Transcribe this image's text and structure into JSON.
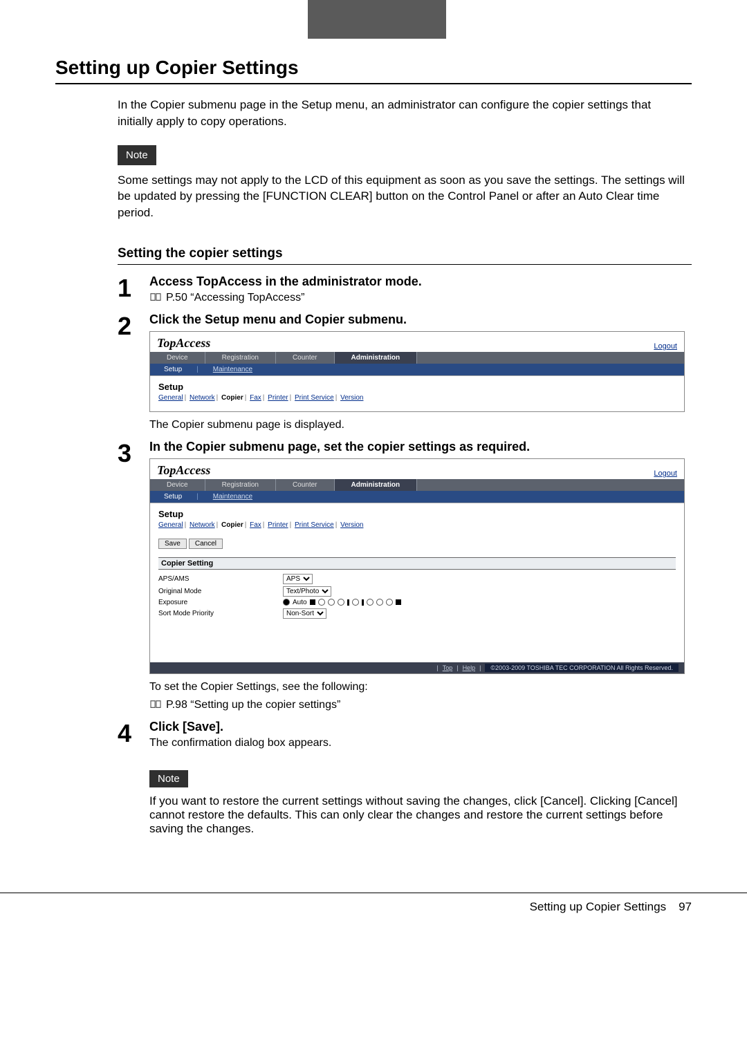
{
  "header": {
    "ribbon_color": "#5a5a5a"
  },
  "title": "Setting up Copier Settings",
  "intro": "In the Copier submenu page in the Setup menu, an administrator can configure the copier settings that initially apply to copy operations.",
  "note_label": "Note",
  "note_text": "Some settings may not apply to the LCD of this equipment as soon as you save the settings. The settings will be updated by pressing the [FUNCTION CLEAR] button on the Control Panel or after an Auto Clear time period.",
  "subsection": "Setting the copier settings",
  "steps": [
    {
      "num": "1",
      "title": "Access TopAccess in the administrator mode.",
      "ref": "P.50 “Accessing TopAccess”"
    },
    {
      "num": "2",
      "title": "Click the Setup menu and Copier submenu.",
      "after": "The Copier submenu page is displayed."
    },
    {
      "num": "3",
      "title": "In the Copier submenu page, set the copier settings as required.",
      "after1": "To set the Copier Settings, see the following:",
      "ref": "P.98 “Setting up the copier settings”"
    },
    {
      "num": "4",
      "title": "Click [Save].",
      "after": "The confirmation dialog box appears."
    }
  ],
  "note2_text": "If you want to restore the current settings without saving the changes, click [Cancel]. Clicking [Cancel] cannot restore the defaults.  This can only clear the changes and restore the current settings before saving the changes.",
  "footer": {
    "title": "Setting up Copier Settings",
    "page": "97"
  },
  "topaccess": {
    "logo": "TopAccess",
    "logout": "Logout",
    "main_tabs": [
      "Device",
      "Registration",
      "Counter",
      "Administration"
    ],
    "active_main": "Administration",
    "sub_tabs": [
      "Setup",
      "Maintenance"
    ],
    "active_sub": "Setup",
    "section_title": "Setup",
    "setup_tabs": [
      "General",
      "Network",
      "Copier",
      "Fax",
      "Printer",
      "Print Service",
      "Version"
    ],
    "active_setup": "Copier",
    "buttons": {
      "save": "Save",
      "cancel": "Cancel"
    },
    "panel_title": "Copier Setting",
    "settings": {
      "aps": {
        "label": "APS/AMS",
        "value": "APS"
      },
      "original": {
        "label": "Original Mode",
        "value": "Text/Photo"
      },
      "exposure": {
        "label": "Exposure",
        "auto_label": "Auto"
      },
      "sort": {
        "label": "Sort Mode Priority",
        "value": "Non-Sort"
      }
    },
    "footer_links": {
      "top": "Top",
      "help": "Help"
    },
    "copyright": "©2003-2009 TOSHIBA TEC CORPORATION All Rights Reserved."
  }
}
